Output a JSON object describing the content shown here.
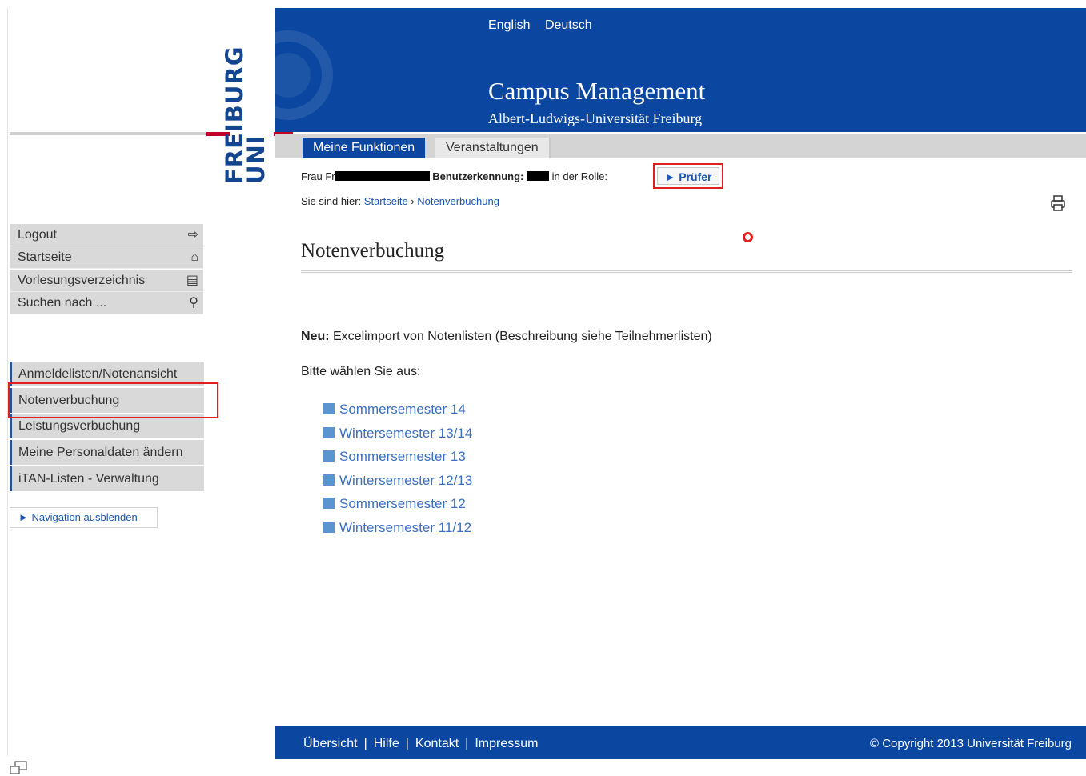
{
  "header": {
    "languages": [
      "English",
      "Deutsch"
    ],
    "title": "Campus Management",
    "subtitle": "Albert-Ludwigs-Universität Freiburg"
  },
  "logo": {
    "line1": "UNI",
    "line2": "FREIBURG"
  },
  "tabs": [
    {
      "label": "Meine Funktionen",
      "active": true
    },
    {
      "label": "Veranstaltungen",
      "active": false
    }
  ],
  "user": {
    "salutation": "Frau Fr",
    "id_label": "Benutzerkennung:",
    "role_label": "in der Rolle:",
    "role_button": "► Prüfer"
  },
  "breadcrumb": {
    "prefix": "Sie sind hier:",
    "items": [
      "Startseite",
      "Notenverbuchung"
    ],
    "separator": "›"
  },
  "main": {
    "title": "Notenverbuchung",
    "new_bold": "Neu:",
    "new_text": " Excelimport von Notenlisten (Beschreibung siehe Teilnehmerlisten)",
    "choose_text": "Bitte wählen Sie aus:",
    "semesters": [
      "Sommersemester 14",
      "Wintersemester 13/14",
      "Sommersemester 13",
      "Wintersemester 12/13",
      "Sommersemester 12",
      "Wintersemester 11/12"
    ]
  },
  "sidebar": {
    "top_items": [
      {
        "label": "Logout",
        "icon": "logout-icon"
      },
      {
        "label": "Startseite",
        "icon": "home-icon"
      },
      {
        "label": "Vorlesungsverzeichnis",
        "icon": "catalog-icon"
      },
      {
        "label": "Suchen nach ...",
        "icon": "search-icon"
      }
    ],
    "function_items": [
      "Anmeldelisten/Notenansicht",
      "Notenverbuchung",
      "Leistungsverbuchung",
      "Meine Personaldaten ändern",
      "iTAN-Listen - Verwaltung"
    ],
    "hide_nav": "► Navigation ausblenden"
  },
  "footer": {
    "links": [
      "Übersicht",
      "Hilfe",
      "Kontakt",
      "Impressum"
    ],
    "copyright": "© Copyright 2013 Universität Freiburg"
  },
  "colors": {
    "brand_blue": "#0b47a0",
    "brand_red": "#c1002a",
    "link_blue": "#1b55b5",
    "highlight_red": "#e0201f"
  }
}
